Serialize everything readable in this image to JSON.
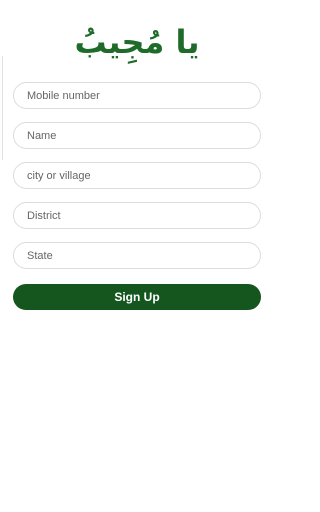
{
  "header": {
    "logo_text": "يا مُجِيبُ"
  },
  "form": {
    "mobile_placeholder": "Mobile number",
    "name_placeholder": "Name",
    "city_placeholder": "city or village",
    "district_placeholder": "District",
    "state_placeholder": "State",
    "signup_label": "Sign Up"
  },
  "colors": {
    "brand_green": "#15561f",
    "logo_green": "#1e6b2a",
    "field_border": "#dcdcdc"
  }
}
